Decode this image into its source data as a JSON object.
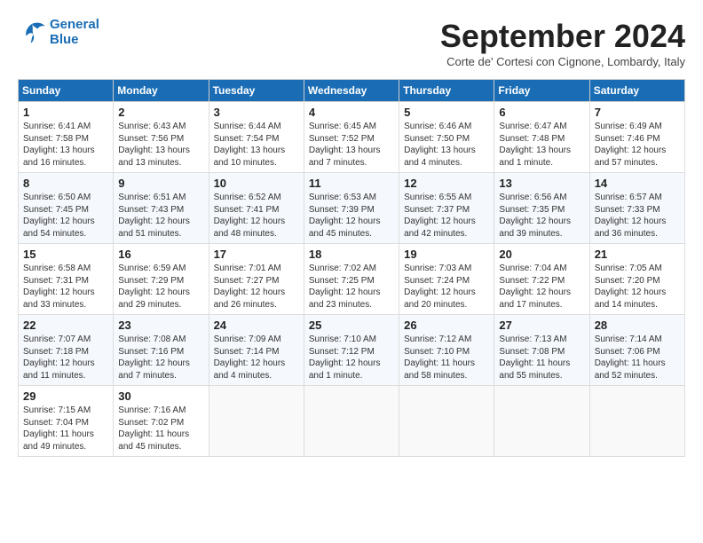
{
  "header": {
    "logo_line1": "General",
    "logo_line2": "Blue",
    "month_title": "September 2024",
    "subtitle": "Corte de' Cortesi con Cignone, Lombardy, Italy"
  },
  "days_of_week": [
    "Sunday",
    "Monday",
    "Tuesday",
    "Wednesday",
    "Thursday",
    "Friday",
    "Saturday"
  ],
  "weeks": [
    [
      {
        "day": "1",
        "info": "Sunrise: 6:41 AM\nSunset: 7:58 PM\nDaylight: 13 hours\nand 16 minutes."
      },
      {
        "day": "2",
        "info": "Sunrise: 6:43 AM\nSunset: 7:56 PM\nDaylight: 13 hours\nand 13 minutes."
      },
      {
        "day": "3",
        "info": "Sunrise: 6:44 AM\nSunset: 7:54 PM\nDaylight: 13 hours\nand 10 minutes."
      },
      {
        "day": "4",
        "info": "Sunrise: 6:45 AM\nSunset: 7:52 PM\nDaylight: 13 hours\nand 7 minutes."
      },
      {
        "day": "5",
        "info": "Sunrise: 6:46 AM\nSunset: 7:50 PM\nDaylight: 13 hours\nand 4 minutes."
      },
      {
        "day": "6",
        "info": "Sunrise: 6:47 AM\nSunset: 7:48 PM\nDaylight: 13 hours\nand 1 minute."
      },
      {
        "day": "7",
        "info": "Sunrise: 6:49 AM\nSunset: 7:46 PM\nDaylight: 12 hours\nand 57 minutes."
      }
    ],
    [
      {
        "day": "8",
        "info": "Sunrise: 6:50 AM\nSunset: 7:45 PM\nDaylight: 12 hours\nand 54 minutes."
      },
      {
        "day": "9",
        "info": "Sunrise: 6:51 AM\nSunset: 7:43 PM\nDaylight: 12 hours\nand 51 minutes."
      },
      {
        "day": "10",
        "info": "Sunrise: 6:52 AM\nSunset: 7:41 PM\nDaylight: 12 hours\nand 48 minutes."
      },
      {
        "day": "11",
        "info": "Sunrise: 6:53 AM\nSunset: 7:39 PM\nDaylight: 12 hours\nand 45 minutes."
      },
      {
        "day": "12",
        "info": "Sunrise: 6:55 AM\nSunset: 7:37 PM\nDaylight: 12 hours\nand 42 minutes."
      },
      {
        "day": "13",
        "info": "Sunrise: 6:56 AM\nSunset: 7:35 PM\nDaylight: 12 hours\nand 39 minutes."
      },
      {
        "day": "14",
        "info": "Sunrise: 6:57 AM\nSunset: 7:33 PM\nDaylight: 12 hours\nand 36 minutes."
      }
    ],
    [
      {
        "day": "15",
        "info": "Sunrise: 6:58 AM\nSunset: 7:31 PM\nDaylight: 12 hours\nand 33 minutes."
      },
      {
        "day": "16",
        "info": "Sunrise: 6:59 AM\nSunset: 7:29 PM\nDaylight: 12 hours\nand 29 minutes."
      },
      {
        "day": "17",
        "info": "Sunrise: 7:01 AM\nSunset: 7:27 PM\nDaylight: 12 hours\nand 26 minutes."
      },
      {
        "day": "18",
        "info": "Sunrise: 7:02 AM\nSunset: 7:25 PM\nDaylight: 12 hours\nand 23 minutes."
      },
      {
        "day": "19",
        "info": "Sunrise: 7:03 AM\nSunset: 7:24 PM\nDaylight: 12 hours\nand 20 minutes."
      },
      {
        "day": "20",
        "info": "Sunrise: 7:04 AM\nSunset: 7:22 PM\nDaylight: 12 hours\nand 17 minutes."
      },
      {
        "day": "21",
        "info": "Sunrise: 7:05 AM\nSunset: 7:20 PM\nDaylight: 12 hours\nand 14 minutes."
      }
    ],
    [
      {
        "day": "22",
        "info": "Sunrise: 7:07 AM\nSunset: 7:18 PM\nDaylight: 12 hours\nand 11 minutes."
      },
      {
        "day": "23",
        "info": "Sunrise: 7:08 AM\nSunset: 7:16 PM\nDaylight: 12 hours\nand 7 minutes."
      },
      {
        "day": "24",
        "info": "Sunrise: 7:09 AM\nSunset: 7:14 PM\nDaylight: 12 hours\nand 4 minutes."
      },
      {
        "day": "25",
        "info": "Sunrise: 7:10 AM\nSunset: 7:12 PM\nDaylight: 12 hours\nand 1 minute."
      },
      {
        "day": "26",
        "info": "Sunrise: 7:12 AM\nSunset: 7:10 PM\nDaylight: 11 hours\nand 58 minutes."
      },
      {
        "day": "27",
        "info": "Sunrise: 7:13 AM\nSunset: 7:08 PM\nDaylight: 11 hours\nand 55 minutes."
      },
      {
        "day": "28",
        "info": "Sunrise: 7:14 AM\nSunset: 7:06 PM\nDaylight: 11 hours\nand 52 minutes."
      }
    ],
    [
      {
        "day": "29",
        "info": "Sunrise: 7:15 AM\nSunset: 7:04 PM\nDaylight: 11 hours\nand 49 minutes."
      },
      {
        "day": "30",
        "info": "Sunrise: 7:16 AM\nSunset: 7:02 PM\nDaylight: 11 hours\nand 45 minutes."
      },
      null,
      null,
      null,
      null,
      null
    ]
  ]
}
